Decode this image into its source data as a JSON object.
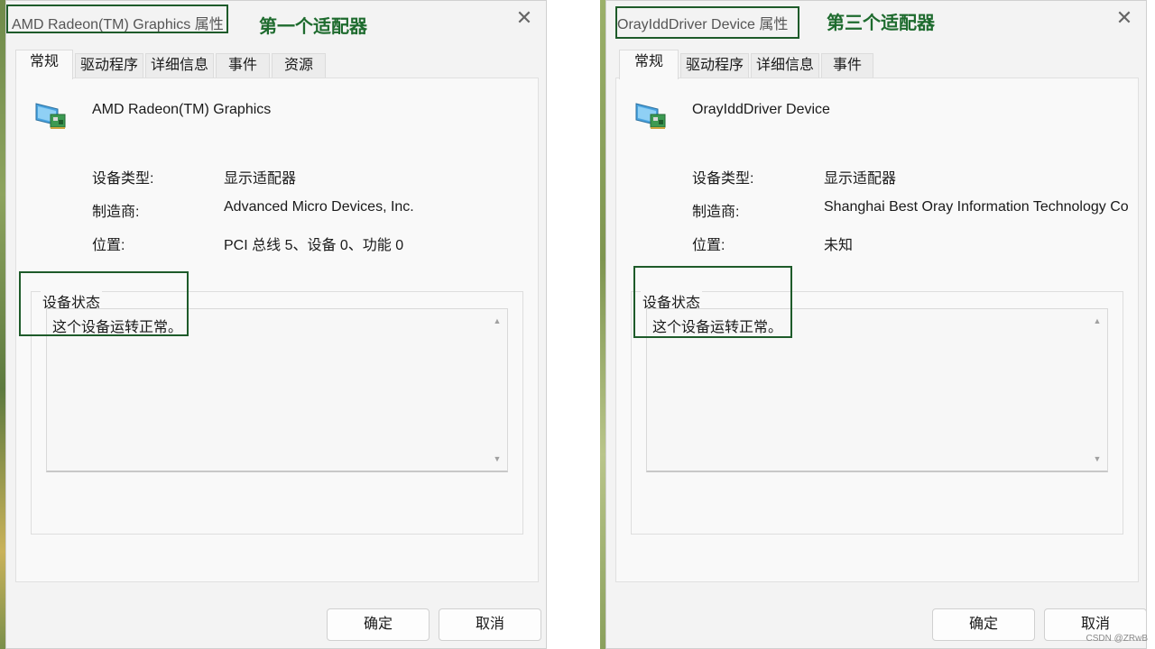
{
  "dialogs": [
    {
      "title": "AMD Radeon(TM) Graphics 属性",
      "annotation": "第一个适配器",
      "tabs": [
        "常规",
        "驱动程序",
        "详细信息",
        "事件",
        "资源"
      ],
      "device_name": "AMD Radeon(TM) Graphics",
      "props": [
        {
          "label": "设备类型:",
          "value": "显示适配器"
        },
        {
          "label": "制造商:",
          "value": "Advanced Micro Devices, Inc."
        },
        {
          "label": "位置:",
          "value": "PCI 总线 5、设备 0、功能 0"
        }
      ],
      "status_title": "设备状态",
      "status_text": "这个设备运转正常。",
      "ok_label": "确定",
      "cancel_label": "取消"
    },
    {
      "title": "OrayIddDriver Device 属性",
      "annotation": "第三个适配器",
      "tabs": [
        "常规",
        "驱动程序",
        "详细信息",
        "事件"
      ],
      "device_name": "OrayIddDriver Device",
      "props": [
        {
          "label": "设备类型:",
          "value": "显示适配器"
        },
        {
          "label": "制造商:",
          "value": "Shanghai Best Oray Information Technology Co"
        },
        {
          "label": "位置:",
          "value": "未知"
        }
      ],
      "status_title": "设备状态",
      "status_text": "这个设备运转正常。",
      "ok_label": "确定",
      "cancel_label": "取消"
    }
  ],
  "close_glyph": "✕",
  "watermark": "CSDN @ZRwB",
  "icons": {
    "device": "display-adapter-icon",
    "close": "close-icon",
    "scroll_up": "scroll-up-icon",
    "scroll_down": "scroll-down-icon"
  },
  "colors": {
    "annotation": "#1e6b2e",
    "annotation_border": "#1e5b2a",
    "dialog_bg": "#f3f3f3",
    "panel_bg": "#f9f9f9"
  }
}
